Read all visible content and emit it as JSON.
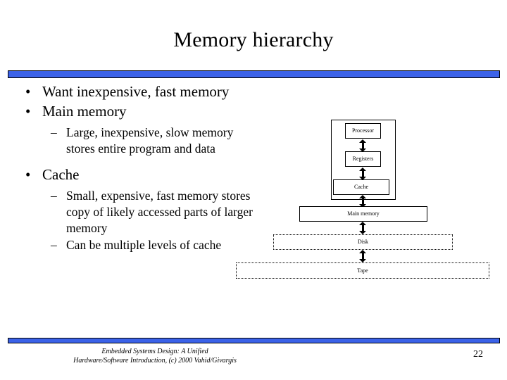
{
  "slide": {
    "title": "Memory hierarchy",
    "page_number": "22",
    "accent_color": "#3b62e8",
    "text_color": "#000000",
    "background_color": "#ffffff"
  },
  "content": {
    "bullets": [
      {
        "marker": "•",
        "text": "Want inexpensive, fast memory",
        "subs": []
      },
      {
        "marker": "•",
        "text": "Main memory",
        "subs": [
          {
            "marker": "–",
            "text": "Large, inexpensive, slow memory stores entire program and data"
          }
        ]
      },
      {
        "marker": "•",
        "text": "Cache",
        "subs": [
          {
            "marker": "–",
            "text": "Small, expensive, fast memory stores copy of likely accessed parts of larger memory"
          },
          {
            "marker": "–",
            "text": "Can be multiple levels of cache"
          }
        ]
      }
    ]
  },
  "diagram": {
    "nodes": [
      {
        "id": "processor-system",
        "label": "",
        "border": "solid"
      },
      {
        "id": "processor",
        "label": "Processor",
        "border": "solid"
      },
      {
        "id": "registers",
        "label": "Registers",
        "border": "solid"
      },
      {
        "id": "cache",
        "label": "Cache",
        "border": "solid"
      },
      {
        "id": "main-memory",
        "label": "Main memory",
        "border": "solid"
      },
      {
        "id": "disk",
        "label": "Disk",
        "border": "dotted"
      },
      {
        "id": "tape",
        "label": "Tape",
        "border": "dotted"
      }
    ],
    "connectors": [
      {
        "from": "processor",
        "to": "registers",
        "type": "double-arrow"
      },
      {
        "from": "registers",
        "to": "cache",
        "type": "double-arrow"
      },
      {
        "from": "cache",
        "to": "main-memory",
        "type": "double-arrow"
      },
      {
        "from": "main-memory",
        "to": "disk",
        "type": "double-arrow"
      },
      {
        "from": "disk",
        "to": "tape",
        "type": "double-arrow"
      }
    ]
  },
  "footer": {
    "line1": "Embedded Systems Design: A Unified",
    "line2": "Hardware/Software Introduction, (c) 2000 Vahid/Givargis"
  }
}
